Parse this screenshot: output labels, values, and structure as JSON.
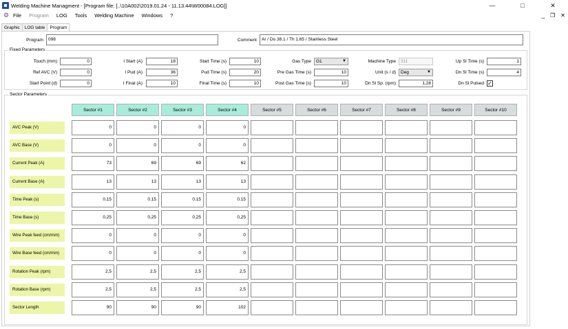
{
  "window": {
    "title": "Welding Machine Managment - [Program file: [..\\10A002\\2019.01.24 - 11.13.44\\W00084.LOG]]",
    "controls": {
      "minimize": "—",
      "maximize": "□",
      "close": "✕"
    },
    "mdi_controls": {
      "minimize": "_",
      "restore": "❐",
      "close": "✕"
    }
  },
  "menu": {
    "icon": "app-menu-icon",
    "items": [
      {
        "label": "File",
        "disabled": false
      },
      {
        "label": "Program",
        "disabled": true
      },
      {
        "label": "LOG",
        "disabled": false
      },
      {
        "label": "Tools",
        "disabled": false
      },
      {
        "label": "Welding Machine",
        "disabled": false
      },
      {
        "label": "Windows",
        "disabled": false
      },
      {
        "label": "?",
        "disabled": false
      }
    ]
  },
  "tabs": [
    {
      "label": "Graphic",
      "active": false
    },
    {
      "label": "LOG table",
      "active": false
    },
    {
      "label": "Program",
      "active": true
    }
  ],
  "program": {
    "program_label": "Program",
    "program_value": "098",
    "comment_label": "Comment",
    "comment_value": "Ar / Do 38.1 / Th 1.65 / Stainless Steel"
  },
  "fixed": {
    "title": "Fixed Parameters",
    "touch_label": "Touch (mm)",
    "touch_value": "0",
    "ref_avc_label": "Ref AVC (V)",
    "ref_avc_value": "0",
    "start_point_label": "Start Point (d)",
    "start_point_value": "0",
    "i_start_label": "I Start (A)",
    "i_start_value": "18",
    "i_pud_label": "I Pud (A)",
    "i_pud_value": "36",
    "i_final_label": "I Final (A)",
    "i_final_value": "10",
    "start_time_label": "Start Time (s)",
    "start_time_value": "10",
    "pud_time_label": "Pud Time (s)",
    "pud_time_value": "20",
    "final_time_label": "Final Time (s)",
    "final_time_value": "10",
    "gas_type_label": "Gas Type",
    "gas_type_value": "G1",
    "pre_gas_label": "Pre Gas Time (s)",
    "pre_gas_value": "10",
    "post_gas_label": "Post Gas Time (s)",
    "post_gas_value": "10",
    "machine_type_label": "Machine Type",
    "machine_type_value": "311",
    "unit_label": "Unit (s / d)",
    "unit_value": "Deg",
    "dn_sl_sp_label": "Dn Sl Sp. (rpm)",
    "dn_sl_sp_value": "1,28",
    "up_sl_time_label": "Up Sl Time (s)",
    "up_sl_time_value": "1",
    "dn_sl_time_label": "Dn Sl Time (s)",
    "dn_sl_time_value": "4",
    "dn_sl_pulsed_label": "Dn Sl Pulsed",
    "dn_sl_pulsed_checked": "✓"
  },
  "sectors": {
    "title": "Sector Parameters",
    "headers": [
      "Sector #1",
      "Sector #2",
      "Sector #3",
      "Sector #4",
      "Sector #5",
      "Sector #6",
      "Sector #7",
      "Sector #8",
      "Sector #9",
      "Sector #10"
    ],
    "active_count": 4,
    "rows": [
      {
        "label": "AVC Peak (V)",
        "values": [
          "0",
          "0",
          "0",
          "0",
          "",
          "",
          "",
          "",
          "",
          ""
        ]
      },
      {
        "label": "AVC Base (V)",
        "values": [
          "0",
          "0",
          "0",
          "0",
          "",
          "",
          "",
          "",
          "",
          ""
        ]
      },
      {
        "label": "Current  Peak (A)",
        "values": [
          "73",
          "69",
          "69",
          "62",
          "",
          "",
          "",
          "",
          "",
          ""
        ]
      },
      {
        "label": "Current  Base (A)",
        "values": [
          "13",
          "13",
          "13",
          "13",
          "",
          "",
          "",
          "",
          "",
          ""
        ]
      },
      {
        "label": "Time Peak (s)",
        "values": [
          "0.15",
          "0.15",
          "0.15",
          "0.15",
          "",
          "",
          "",
          "",
          "",
          ""
        ]
      },
      {
        "label": "Time Base (s)",
        "values": [
          "0,25",
          "0,25",
          "0,25",
          "0,25",
          "",
          "",
          "",
          "",
          "",
          ""
        ]
      },
      {
        "label": "Wire Peak feed (cm/min)",
        "values": [
          "0",
          "0",
          "0",
          "0",
          "",
          "",
          "",
          "",
          "",
          ""
        ]
      },
      {
        "label": "Wire Base feed (cm/min)",
        "values": [
          "0",
          "0",
          "0",
          "0",
          "",
          "",
          "",
          "",
          "",
          ""
        ]
      },
      {
        "label": "Rotation Peak (rpm)",
        "values": [
          "2,5",
          "2,5",
          "2,5",
          "2,5",
          "",
          "",
          "",
          "",
          "",
          ""
        ]
      },
      {
        "label": "Rotation Base (rpm)",
        "values": [
          "2,5",
          "2,5",
          "2,5",
          "2,5",
          "",
          "",
          "",
          "",
          "",
          ""
        ]
      },
      {
        "label": "Sector Length",
        "values": [
          "90",
          "90",
          "90",
          "102",
          "",
          "",
          "",
          "",
          "",
          ""
        ]
      }
    ]
  }
}
